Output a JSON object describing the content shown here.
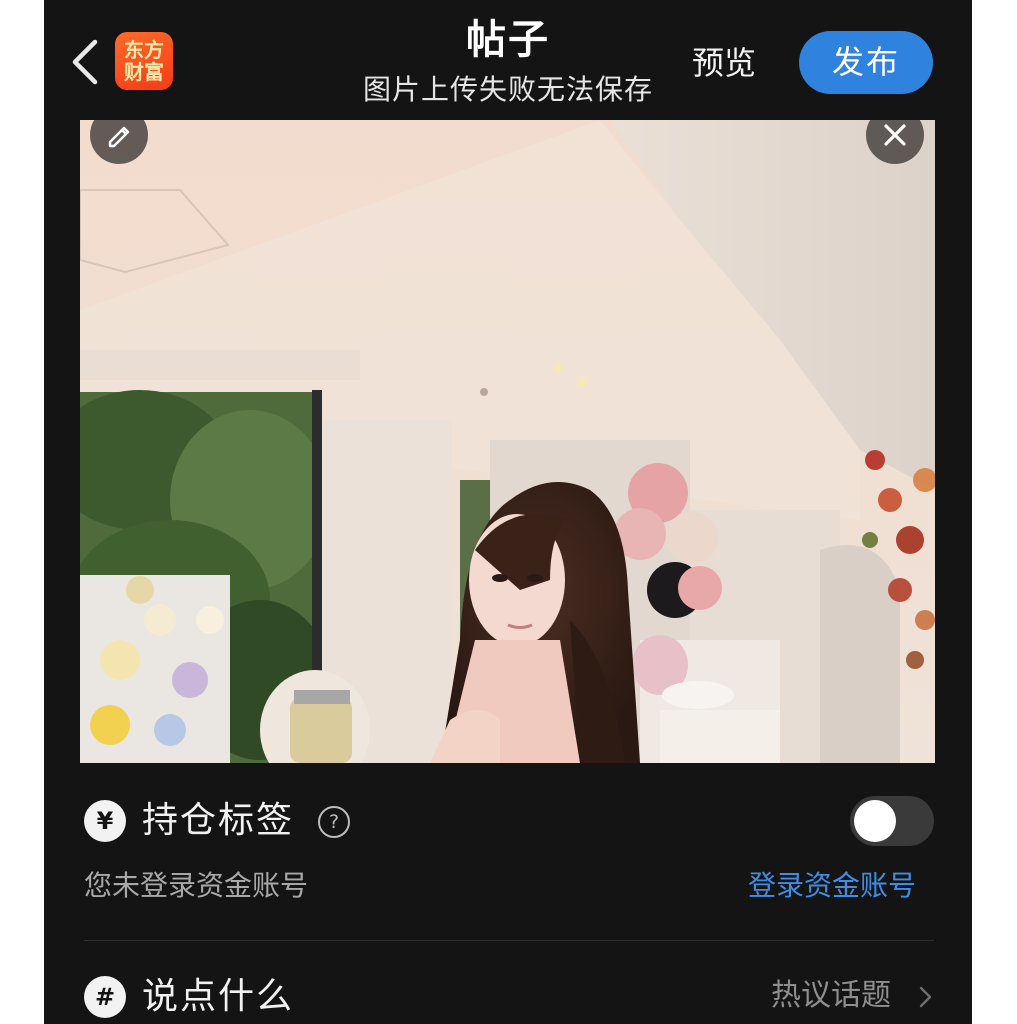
{
  "header": {
    "app_logo_line1": "东方",
    "app_logo_line2": "财富",
    "title": "帖子",
    "subtitle": "图片上传失败无法保存",
    "preview_label": "预览",
    "publish_label": "发布"
  },
  "photo": {
    "edit_icon": "pencil-icon",
    "close_icon": "close-icon"
  },
  "holding_tag": {
    "icon_glyph": "¥",
    "label": "持仓标签",
    "help_glyph": "?",
    "toggle_on": false,
    "login_hint": "您未登录资金账号",
    "login_link": "登录资金账号"
  },
  "say_something": {
    "icon_glyph": "#",
    "label": "说点什么",
    "topic_link": "热议话题"
  },
  "colors": {
    "accent_blue": "#2f82dd",
    "link_blue": "#3d8ee6",
    "background": "#141414",
    "logo_orange": "#f13d16"
  }
}
